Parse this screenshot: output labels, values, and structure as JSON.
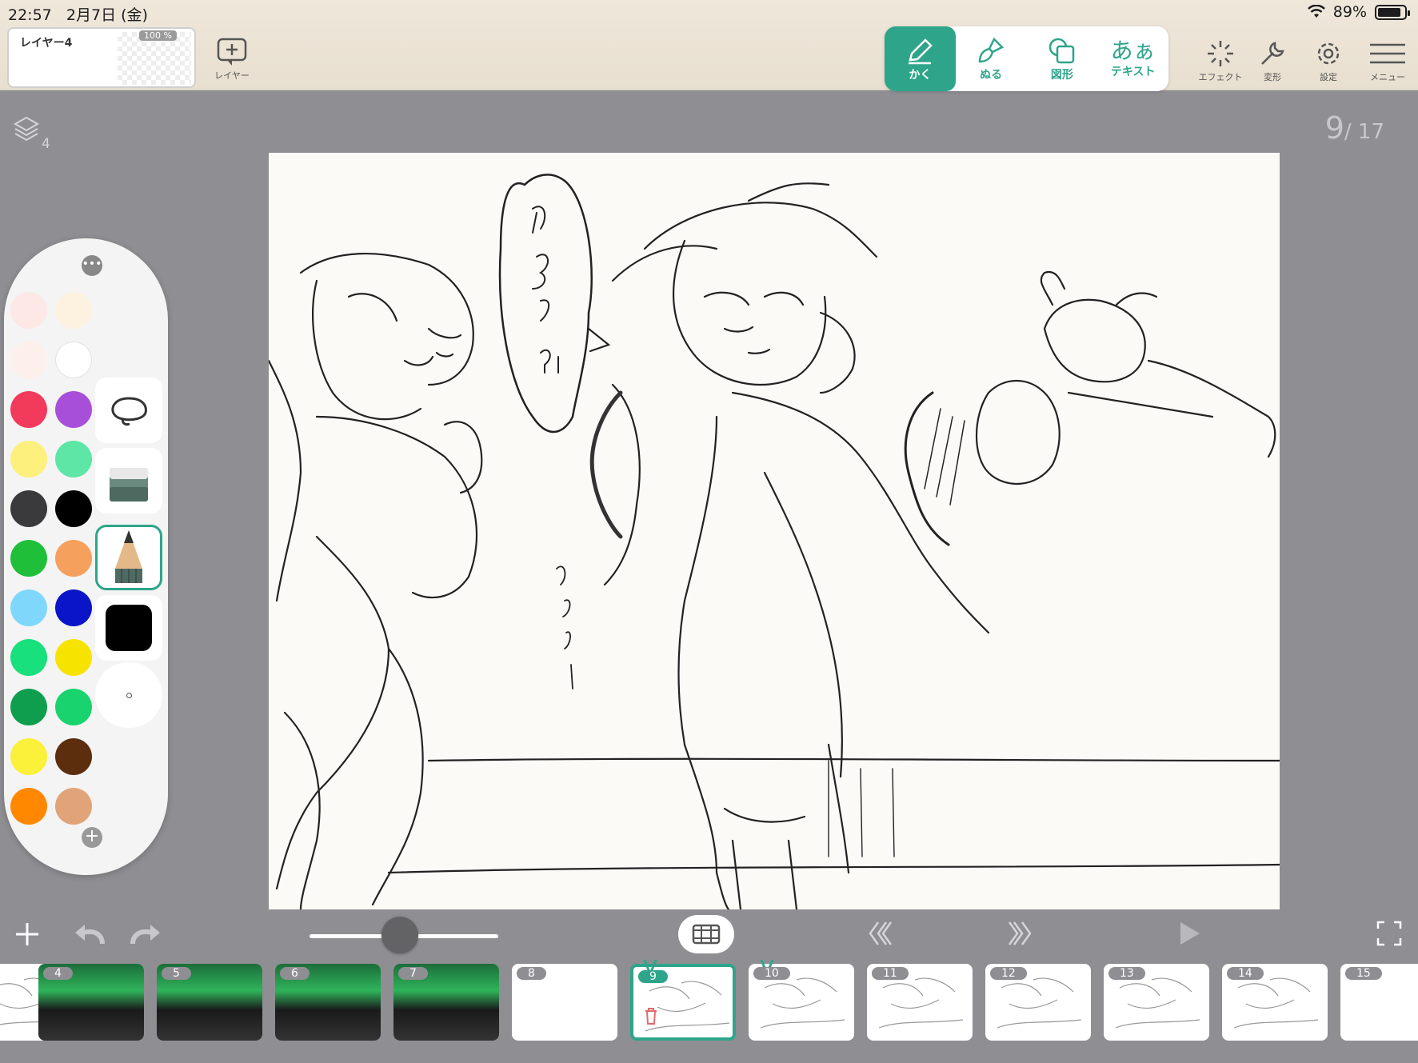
{
  "status": {
    "time": "22:57",
    "date": "2月7日 (金)",
    "battery": "89%"
  },
  "layer": {
    "name": "レイヤー4",
    "opacity": "100 %"
  },
  "toolbar": {
    "add_layer_label": "レイヤー",
    "tools": [
      {
        "label": "かく",
        "active": true
      },
      {
        "label": "ぬる",
        "active": false
      },
      {
        "label": "図形",
        "active": false
      },
      {
        "label": "テキスト",
        "glyph": "あぁ",
        "active": false
      }
    ],
    "effect_label": "エフェクト",
    "transform_label": "変形",
    "settings_label": "設定",
    "menu_label": "メニュー"
  },
  "canvas": {
    "layer_count": "4",
    "page_current": "9",
    "page_total": "/ 17"
  },
  "palette": {
    "colors": [
      "#fde8e6",
      "#fdf1e0",
      "#fdf0ea",
      "#ffffff",
      "#f23a5c",
      "#a74fd8",
      "#fdf07c",
      "#5de6a6",
      "#3a3a3c",
      "#000000",
      "#1fbf3a",
      "#f6a05e",
      "#7fd8fb",
      "#0a14c8",
      "#17e07c",
      "#f7e300",
      "#0e9e4e",
      "#18d36e",
      "#fbf03a",
      "#5c2e0e",
      "#ff8800",
      "#e1a478"
    ],
    "current_color": "#000000"
  },
  "timeline": {
    "frames": [
      {
        "num": "",
        "kind": "sketch"
      },
      {
        "num": "4",
        "kind": "color"
      },
      {
        "num": "5",
        "kind": "color"
      },
      {
        "num": "6",
        "kind": "color"
      },
      {
        "num": "7",
        "kind": "color"
      },
      {
        "num": "8",
        "kind": "blank"
      },
      {
        "num": "9",
        "kind": "sketch",
        "selected": true
      },
      {
        "num": "10",
        "kind": "sketch"
      },
      {
        "num": "11",
        "kind": "sketch"
      },
      {
        "num": "12",
        "kind": "sketch"
      },
      {
        "num": "13",
        "kind": "sketch"
      },
      {
        "num": "14",
        "kind": "sketch"
      },
      {
        "num": "15",
        "kind": "blank"
      }
    ]
  },
  "accent_color": "#2ea58a"
}
